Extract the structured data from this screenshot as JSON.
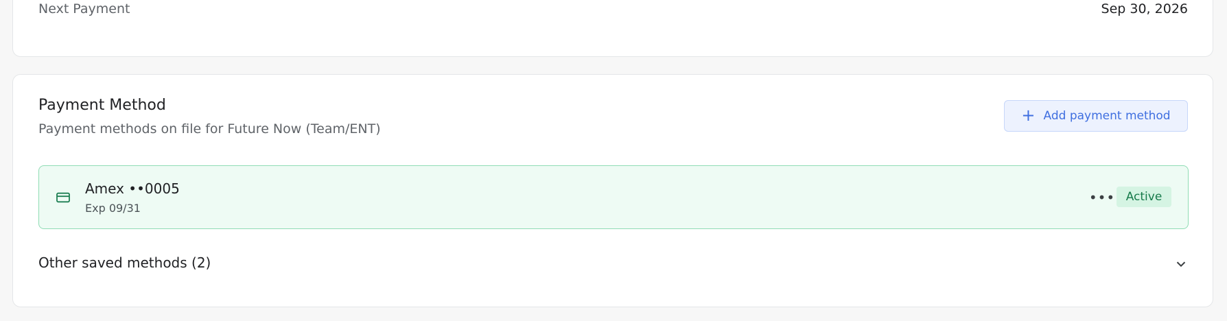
{
  "next_payment": {
    "label": "Next Payment",
    "value": "Sep 30, 2026"
  },
  "payment_method": {
    "title": "Payment Method",
    "subtitle": "Payment methods on file for Future Now (Team/ENT)",
    "add_button": {
      "label": "Add payment method",
      "icon": "plus-icon"
    },
    "card": {
      "name": "Amex ••0005",
      "expiry": "Exp 09/31",
      "status": "Active",
      "icon": "credit-card-icon",
      "menu_icon": "more-icon"
    },
    "other_saved": {
      "label": "Other saved methods (2)",
      "icon": "chevron-down-icon"
    }
  },
  "colors": {
    "accent_blue": "#3f6fe0",
    "success_green": "#167a4a",
    "success_bg": "#eefbf4"
  }
}
